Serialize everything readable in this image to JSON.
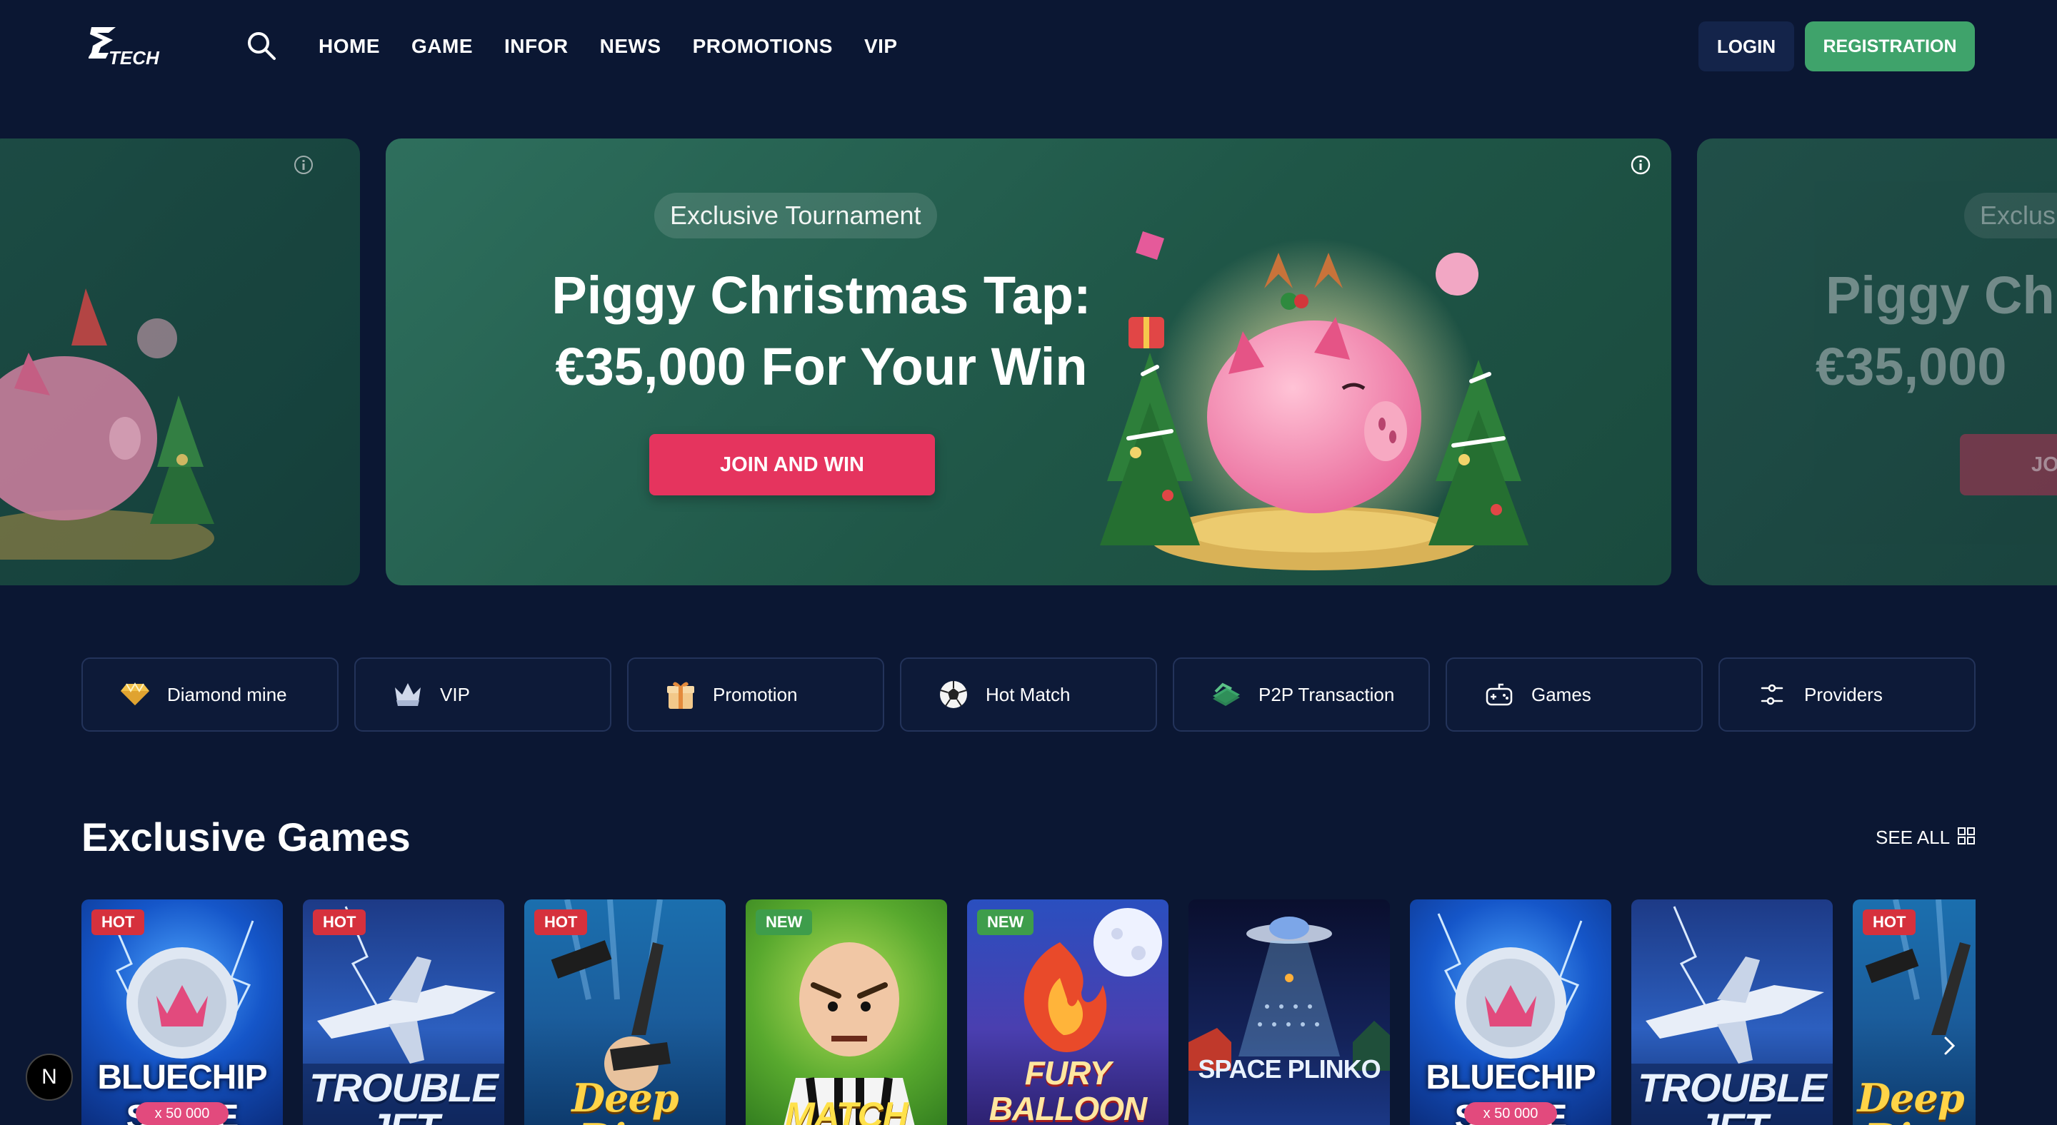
{
  "header": {
    "logo_text": "TECH",
    "nav": [
      "HOME",
      "GAME",
      "INFOR",
      "NEWS",
      "PROMOTIONS",
      "VIP"
    ],
    "login_label": "LOGIN",
    "register_label": "REGISTRATION"
  },
  "banner": {
    "badge": "Exclusive Tournament",
    "title_line1": "Piggy Christmas Tap:",
    "title_line2": "€35,000 For Your Win",
    "cta": "JOIN AND WIN",
    "next_badge": "Exclusi",
    "next_title_line1": "Piggy Ch",
    "next_title_line2": "€35,000",
    "next_cta": "JO"
  },
  "categories": [
    {
      "label": "Diamond mine",
      "icon": "diamond-icon"
    },
    {
      "label": "VIP",
      "icon": "crown-icon"
    },
    {
      "label": "Promotion",
      "icon": "gift-icon"
    },
    {
      "label": "Hot Match",
      "icon": "soccer-ball-icon"
    },
    {
      "label": "P2P Transaction",
      "icon": "money-icon"
    },
    {
      "label": "Games",
      "icon": "gamepad-icon"
    },
    {
      "label": "Providers",
      "icon": "sliders-icon"
    }
  ],
  "games_section": {
    "title": "Exclusive Games",
    "see_all": "SEE ALL"
  },
  "games": [
    {
      "tag": "HOT",
      "name": "BLUECHIP SPACE",
      "sub": "x 50 000"
    },
    {
      "tag": "HOT",
      "name": "TROUBLE JET",
      "sub": ""
    },
    {
      "tag": "HOT",
      "name": "Deep Dive",
      "sub": ""
    },
    {
      "tag": "NEW",
      "name": "MATCH",
      "sub": ""
    },
    {
      "tag": "NEW",
      "name": "FURY BALLOON",
      "sub": ""
    },
    {
      "tag": "",
      "name": "SPACE PLINKO",
      "sub": ""
    },
    {
      "tag": "",
      "name": "BLUECHIP SPACE",
      "sub": "x 50 000"
    },
    {
      "tag": "",
      "name": "TROUBLE JET",
      "sub": ""
    },
    {
      "tag": "HOT",
      "name": "Deep Dive",
      "sub": ""
    }
  ],
  "floating_badge": "N",
  "colors": {
    "background": "#0b1733",
    "accent_green": "#3fa36b",
    "accent_pink": "#e5345e",
    "banner_green": "#2e6f5d"
  }
}
